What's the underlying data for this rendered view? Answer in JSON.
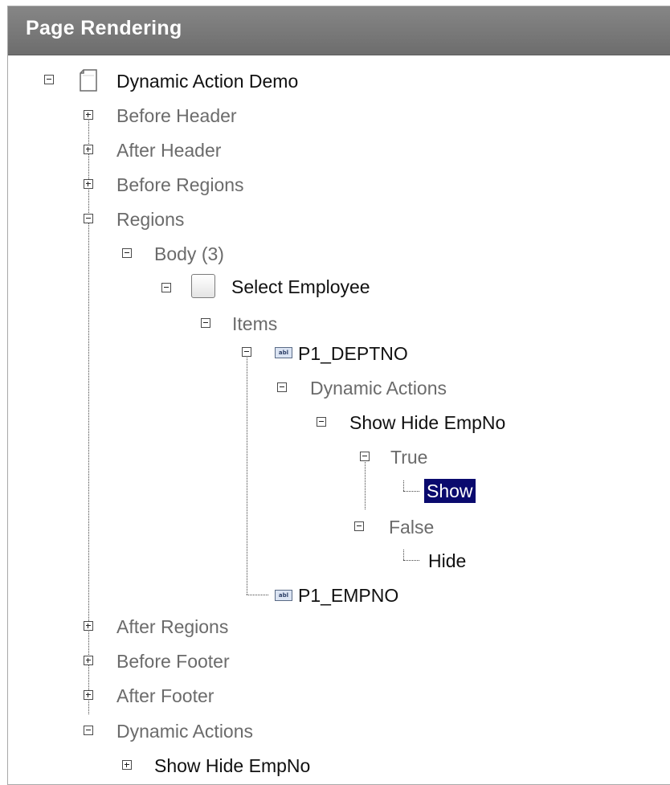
{
  "panel": {
    "title": "Page Rendering"
  },
  "icons": {
    "item_glyph": "abl"
  },
  "tree": {
    "page": "Dynamic Action Demo",
    "before_header": "Before Header",
    "after_header": "After Header",
    "before_regions": "Before Regions",
    "regions": "Regions",
    "body": "Body (3)",
    "region_select_employee": "Select Employee",
    "items": "Items",
    "item_deptno": "P1_DEPTNO",
    "item_dynamic_actions": "Dynamic Actions",
    "item_da_show_hide": "Show Hide EmpNo",
    "true_branch": "True",
    "action_show": "Show",
    "false_branch": "False",
    "action_hide": "Hide",
    "item_empno": "P1_EMPNO",
    "after_regions": "After Regions",
    "before_footer": "Before Footer",
    "after_footer": "After Footer",
    "page_dynamic_actions": "Dynamic Actions",
    "page_da_show_hide": "Show Hide EmpNo"
  }
}
